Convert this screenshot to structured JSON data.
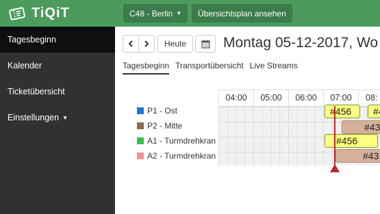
{
  "brand": {
    "name": "TiQiT",
    "logo_icon": "ticket-logo-icon"
  },
  "sidebar": {
    "items": [
      {
        "label": "Tagesbeginn",
        "active": true
      },
      {
        "label": "Kalender"
      },
      {
        "label": "Ticketübersicht"
      },
      {
        "label": "Einstellungen",
        "has_dropdown": true
      }
    ]
  },
  "topbar": {
    "project_selector": "C48 - Berlin",
    "plan_button": "Übersichtsplan ansehen"
  },
  "toolbar": {
    "prev_icon": "chevron-left-icon",
    "next_icon": "chevron-right-icon",
    "today_label": "Heute",
    "calendar_icon": "calendar-icon",
    "date_title": "Montag 05-12-2017, Wo"
  },
  "tabs": [
    {
      "label": "Tagesbeginn",
      "active": true
    },
    {
      "label": "Transportübersicht"
    },
    {
      "label": "Live Streams"
    }
  ],
  "timeline": {
    "hours": [
      "04:00",
      "05:00",
      "06:00",
      "07:00",
      "08:"
    ],
    "resources": [
      {
        "label": "P1 - Ost",
        "color": "#1f77d4"
      },
      {
        "label": "P2 - Mitte",
        "color": "#8b6a4b"
      },
      {
        "label": "A1 - Turmdrehkran",
        "color": "#33c24a"
      },
      {
        "label": "A2 - Turmdrehkran",
        "color": "#f2938f"
      }
    ],
    "events": [
      {
        "label": "#456",
        "resource": 0,
        "style": "yellow"
      },
      {
        "label": "#4",
        "resource": 0,
        "style": "yellow"
      },
      {
        "label": "#43",
        "resource": 1,
        "style": "tan"
      },
      {
        "label": "#456",
        "resource": 2,
        "style": "yellow"
      },
      {
        "label": "#43",
        "resource": 3,
        "style": "tan"
      }
    ],
    "colors": {
      "yellow_event": "#ffff80",
      "tan_event": "#d6b19a",
      "now_indicator": "#c8202b"
    }
  },
  "colors": {
    "brand": "#4c9a5c",
    "sidebar": "#2f3133",
    "sidebar_active": "#0e0f10"
  }
}
